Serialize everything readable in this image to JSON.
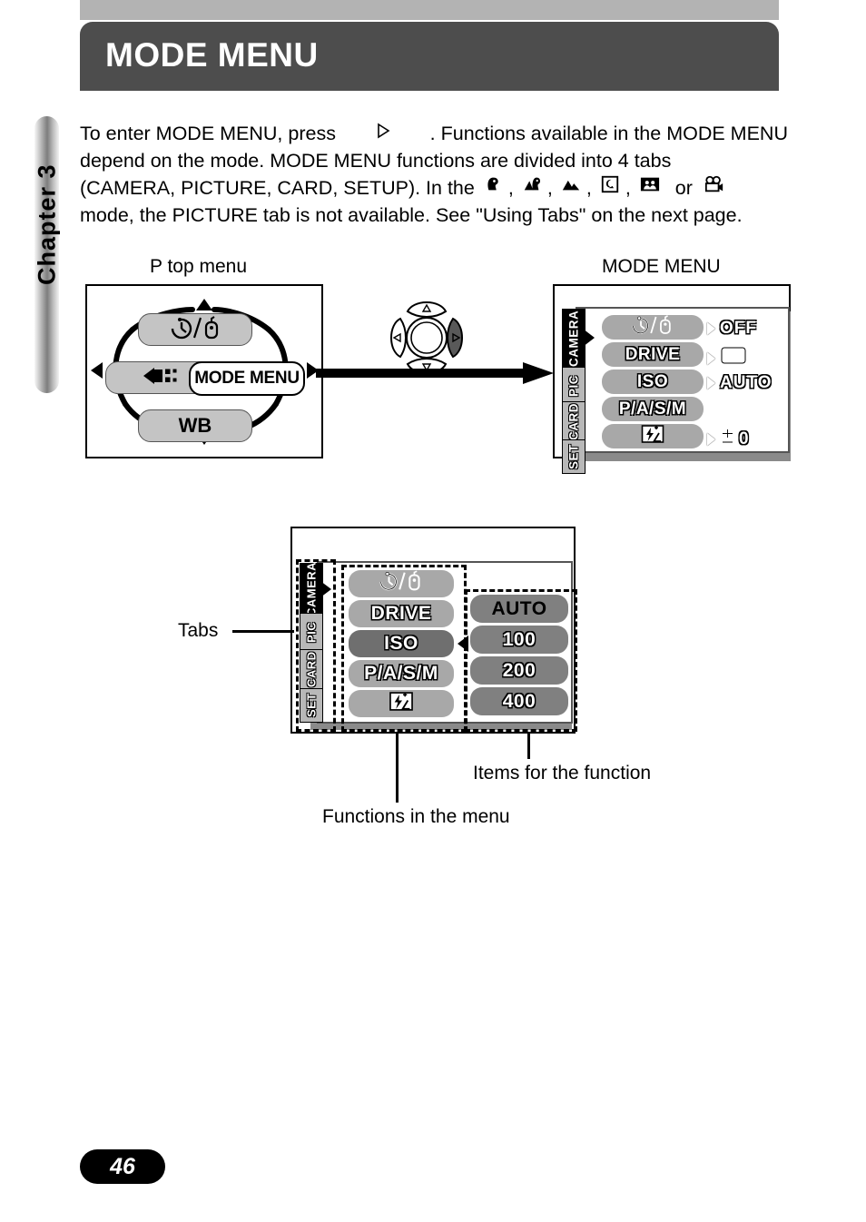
{
  "header": {
    "title": "MODE MENU"
  },
  "chapter": {
    "label": "Chapter 3"
  },
  "body": {
    "line1_a": "To enter MODE MENU, press",
    "line1_b": ". Functions available in the MODE MENU",
    "line2": "depend on the mode. MODE MENU functions are divided into 4 tabs",
    "line3_a": "(CAMERA, PICTURE, CARD, SETUP). In the",
    "line3_sep": ",",
    "line3_or": "or",
    "line4": "mode, the PICTURE tab is not available. See \"Using Tabs\" on the next page.",
    "mode_icons": [
      "portrait-mode-icon",
      "portrait-landscape-mode-icon",
      "landscape-mode-icon",
      "night-scene-mode-icon",
      "self-portrait-mode-icon",
      "movie-mode-icon"
    ]
  },
  "figure_top": {
    "left_caption": "P top menu",
    "right_caption": "MODE MENU",
    "top_menu": {
      "up_item": "self-timer-remote-icon",
      "left_item": "image-quality-icon",
      "right_item": "MODE MENU",
      "down_item": "WB"
    },
    "arrow_pad": {
      "name": "four-way-arrow-pad",
      "highlighted": "right"
    },
    "mode_menu": {
      "tabs": [
        {
          "label": "CAMERA",
          "active": true
        },
        {
          "label": "PIC",
          "active": false
        },
        {
          "label": "CARD",
          "active": false
        },
        {
          "label": "SET",
          "active": false
        }
      ],
      "rows": [
        {
          "function": "",
          "function_icon": "self-timer-remote-icon",
          "value": "OFF",
          "value_icon": ""
        },
        {
          "function": "DRIVE",
          "function_icon": "",
          "value": "",
          "value_icon": "single-frame-icon"
        },
        {
          "function": "ISO",
          "function_icon": "",
          "value": "AUTO",
          "value_icon": ""
        },
        {
          "function": "P/A/S/M",
          "function_icon": "",
          "value": "",
          "value_icon": ""
        },
        {
          "function": "",
          "function_icon": "flash-exposure-comp-icon",
          "value": "0",
          "value_icon": "plus-minus-icon"
        }
      ]
    }
  },
  "figure_bottom": {
    "callouts": {
      "tabs": "Tabs",
      "functions": "Functions in the menu",
      "items": "Items for the function"
    },
    "tabs": [
      {
        "label": "CAMERA",
        "active": true
      },
      {
        "label": "PIC",
        "active": false
      },
      {
        "label": "CARD",
        "active": false
      },
      {
        "label": "SET",
        "active": false
      }
    ],
    "functions": [
      {
        "label": "",
        "icon": "self-timer-remote-icon",
        "selected": false
      },
      {
        "label": "DRIVE",
        "icon": "",
        "selected": false
      },
      {
        "label": "ISO",
        "icon": "",
        "selected": true
      },
      {
        "label": "P/A/S/M",
        "icon": "",
        "selected": false
      },
      {
        "label": "",
        "icon": "flash-exposure-comp-icon",
        "selected": false
      }
    ],
    "items": [
      {
        "label": "AUTO",
        "selected": true
      },
      {
        "label": "100",
        "selected": false
      },
      {
        "label": "200",
        "selected": false
      },
      {
        "label": "400",
        "selected": false
      }
    ]
  },
  "footer": {
    "page_number": "46"
  },
  "colors": {
    "title_bar": "#4d4d4d",
    "top_bar": "#b3b3b3",
    "pill": "#c4c4c4",
    "func_pill": "#a8a8a8",
    "func_pill_selected": "#6f6f6f",
    "item_pill": "#808080",
    "tab_active": "#000000",
    "tab_inactive": "#b8b8b8"
  }
}
